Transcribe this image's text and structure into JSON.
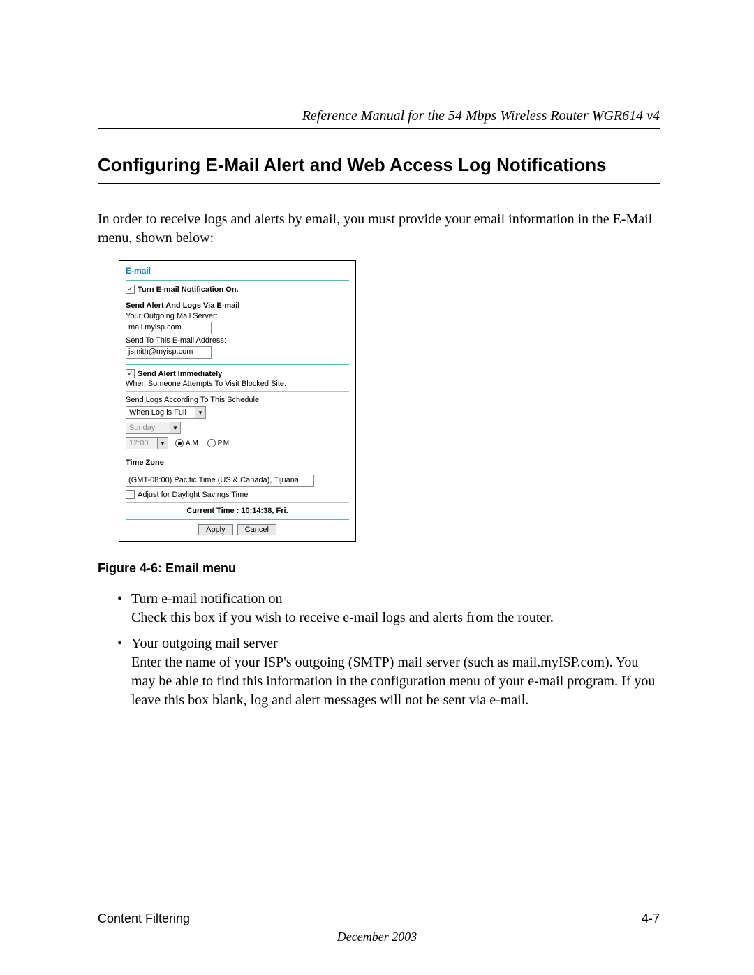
{
  "header": {
    "running": "Reference Manual for the 54 Mbps Wireless Router WGR614 v4"
  },
  "section": {
    "title": "Configuring E-Mail Alert and Web Access Log Notifications",
    "intro": "In order to receive logs and alerts by email, you must provide your email information in the E-Mail menu, shown below:"
  },
  "email_panel": {
    "title": "E-mail",
    "notify_checkbox_label": "Turn E-mail Notification On.",
    "notify_checked_mark": "✓",
    "alerts": {
      "heading": "Send Alert And Logs Via E-mail",
      "outgoing_label": "Your Outgoing Mail Server:",
      "outgoing_value": "mail.myisp.com",
      "sendto_label": "Send To This E-mail Address:",
      "sendto_value": "jsmith@myisp.com"
    },
    "immediate": {
      "checked_mark": "✓",
      "label": "Send Alert Immediately",
      "sublabel": "When Someone Attempts To Visit Blocked Site."
    },
    "schedule": {
      "heading": "Send Logs According To This Schedule",
      "freq_value": "When Log is Full",
      "day_value": "Sunday",
      "time_value": "12:00",
      "am_label": "A.M.",
      "pm_label": "P.M."
    },
    "timezone": {
      "heading": "Time Zone",
      "value": "(GMT-08:00) Pacific Time (US & Canada), Tijuana",
      "dst_label": "Adjust for Daylight Savings Time",
      "current_time": "Current Time : 10:14:38, Fri."
    },
    "buttons": {
      "apply": "Apply",
      "cancel": "Cancel"
    }
  },
  "figure_caption": "Figure 4-6:  Email menu",
  "bullets": {
    "b1_title": "Turn e-mail notification on",
    "b1_body": "Check this box if you wish to receive e-mail logs and alerts from the router.",
    "b2_title": "Your outgoing mail server",
    "b2_body": "Enter the name of your ISP's outgoing (SMTP) mail server (such as mail.myISP.com). You may be able to find this information in the configuration menu of your e-mail program. If you leave this box blank, log and alert messages will not be sent via e-mail."
  },
  "footer": {
    "left": "Content Filtering",
    "right": "4-7",
    "date": "December 2003"
  },
  "glyphs": {
    "down": "▼"
  }
}
